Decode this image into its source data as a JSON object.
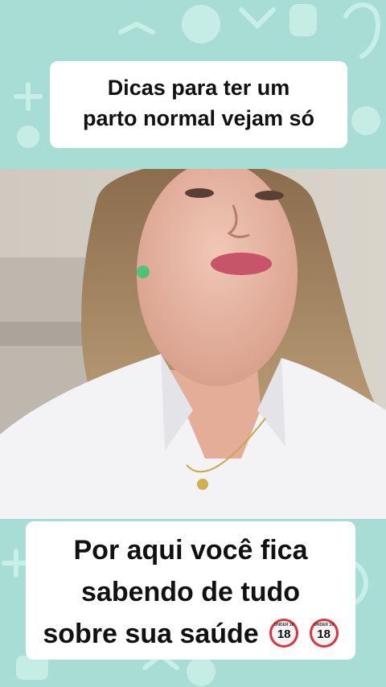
{
  "video": {
    "caption_top": {
      "line1": "Dicas para ter um",
      "line2": "parto normal vejam só"
    },
    "caption_bottom": {
      "line1": "Por aqui você fica",
      "line2": "sabendo de tudo",
      "line3": "sobre sua saúde",
      "emoji_label": "UNDER 18",
      "emoji_number": "18"
    }
  },
  "colors": {
    "background": "#a8ddd6",
    "pattern": "#c6ece6",
    "caption_bg": "#ffffff",
    "caption_text": "#111111",
    "emoji_red": "#e0323a"
  }
}
